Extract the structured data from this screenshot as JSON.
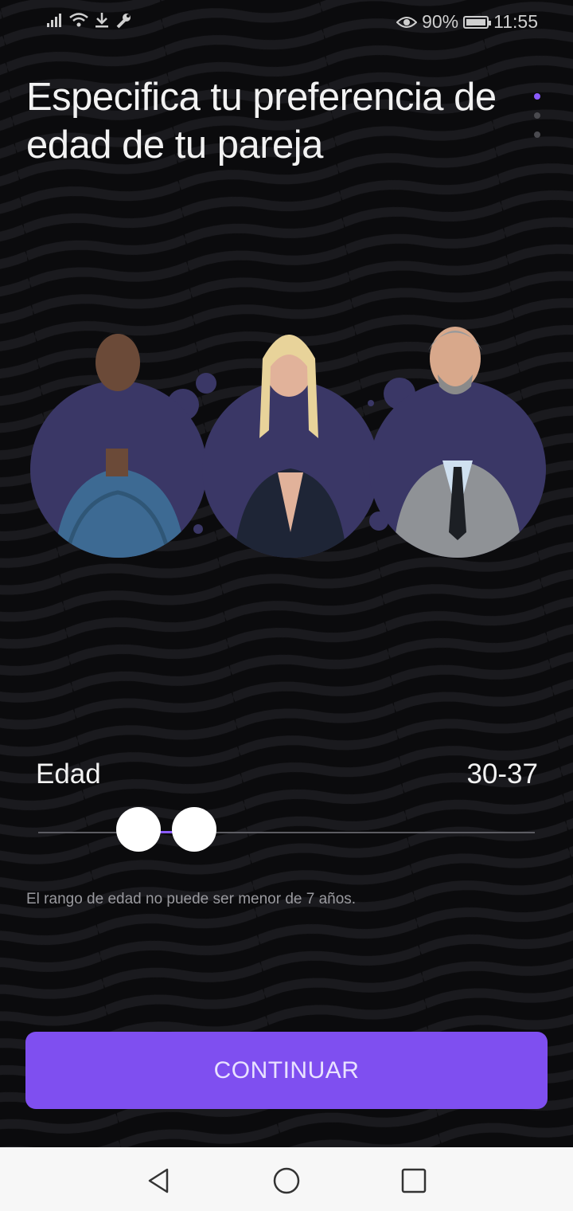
{
  "status_bar": {
    "battery_percent": "90%",
    "time": "11:55",
    "icons": [
      "signal-icon",
      "wifi-icon",
      "download-icon",
      "wrench-icon",
      "eye-icon",
      "battery-icon"
    ]
  },
  "page": {
    "title": "Especifica tu preferencia de edad de tu pareja",
    "pager": {
      "total": 3,
      "active": 1
    }
  },
  "age_filter": {
    "label": "Edad",
    "value_text": "30-37",
    "min": 30,
    "max": 37,
    "hint": "El rango de edad no puede ser menor de 7 años."
  },
  "actions": {
    "continue_label": "CONTINUAR"
  },
  "colors": {
    "accent": "#7f4ff0",
    "circle_bg": "#3a3766",
    "background": "#0b0b0d"
  },
  "nav_bar": {
    "icons": [
      "back-icon",
      "home-icon",
      "recents-icon"
    ]
  }
}
